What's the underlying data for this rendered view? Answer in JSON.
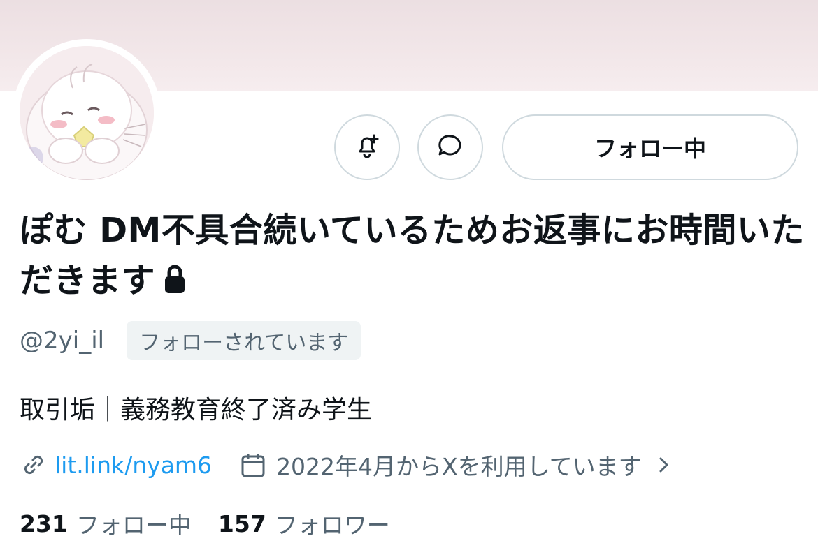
{
  "profile": {
    "display_name": "ぽむ DM不具合続いているためお返事にお時間いただきます",
    "handle": "@2yi_il",
    "follows_you_badge": "フォローされています",
    "bio": "取引垢｜義務教育終了済み学生",
    "link": "lit.link/nyam6",
    "joined": "2022年4月からXを利用しています",
    "protected": true
  },
  "actions": {
    "follow_state_label": "フォロー中",
    "notify_icon": "bell-plus-icon",
    "message_icon": "chat-bubble-icon"
  },
  "stats": {
    "following_count": "231",
    "following_label": "フォロー中",
    "followers_count": "157",
    "followers_label": "フォロワー"
  },
  "colors": {
    "banner": "#efe3e6",
    "link": "#1d9bf0",
    "secondary_text": "#536471",
    "border": "#cfd9de",
    "badge_bg": "#eff3f4"
  }
}
